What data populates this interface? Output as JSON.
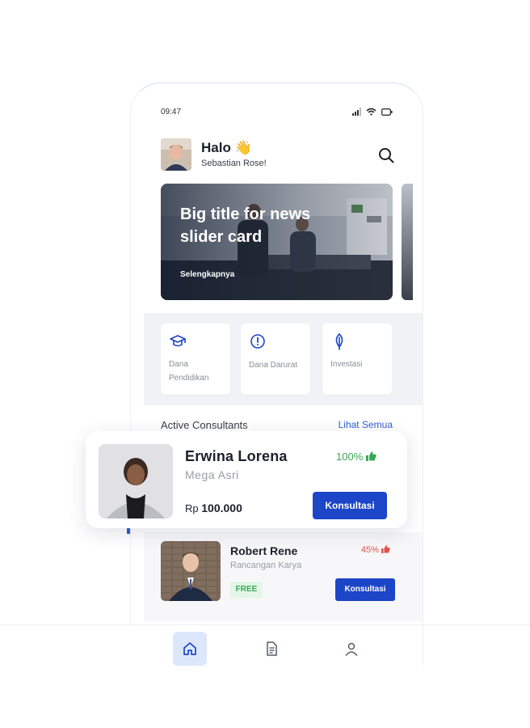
{
  "status_bar": {
    "time": "09:47"
  },
  "header": {
    "greeting": "Halo 👋",
    "user_name": "Sebastian Rose!"
  },
  "news": {
    "title": "Big title for news slider card",
    "link": "Selengkapnya"
  },
  "menu": [
    {
      "label": "Dana Pendidikan",
      "icon": "graduation-cap-icon"
    },
    {
      "label": "Dana Darurat",
      "icon": "alert-circle-icon"
    },
    {
      "label": "Investasi",
      "icon": "leaf-icon"
    }
  ],
  "consultants_section": {
    "title": "Active Consultants",
    "link": "Lihat Semua"
  },
  "featured_consultant": {
    "name": "Erwina Lorena",
    "company": "Mega Asri",
    "price_prefix": "Rp",
    "price": "100.000",
    "rating_percent": "100%",
    "button": "Konsultasi"
  },
  "consultant_2": {
    "name": "Robert Rene",
    "company": "Rancangan Karya",
    "rating_percent": "45%",
    "badge": "FREE",
    "button": "Konsultasi"
  },
  "nav": [
    {
      "icon": "home-icon",
      "active": true
    },
    {
      "icon": "document-icon",
      "active": false
    },
    {
      "icon": "profile-icon",
      "active": false
    }
  ],
  "colors": {
    "primary": "#1c45c8",
    "positive": "#38a857",
    "negative": "#e4524c",
    "link": "#2f5fd0"
  }
}
